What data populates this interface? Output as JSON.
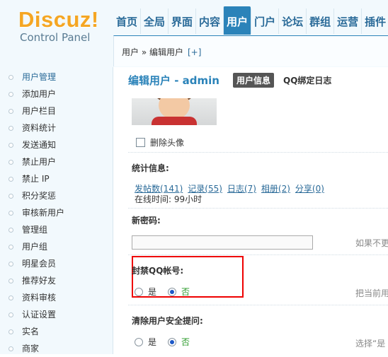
{
  "logo": {
    "title": "Discuz!",
    "subtitle": "Control Panel"
  },
  "nav": [
    "首页",
    "全局",
    "界面",
    "内容",
    "用户",
    "门户",
    "论坛",
    "群组",
    "运营",
    "插件"
  ],
  "nav_active": "用户",
  "breadcrumb": {
    "text": "用户 » 编辑用户",
    "add": "[+]"
  },
  "sidebar": {
    "items": [
      "用户管理",
      "添加用户",
      "用户栏目",
      "资料统计",
      "发送通知",
      "禁止用户",
      "禁止 IP",
      "积分奖惩",
      "审核新用户",
      "管理组",
      "用户组",
      "明星会员",
      "推荐好友",
      "资料审核",
      "认证设置",
      "实名",
      "商家"
    ],
    "active": "用户管理"
  },
  "main": {
    "title": "编辑用户 - admin",
    "tabs": [
      "用户信息",
      "QQ绑定日志"
    ],
    "delete_avatar": "删除头像",
    "stats_label": "统计信息:",
    "stats_links": [
      "发帖数(141)",
      "记录(55)",
      "日志(7)",
      "相册(2)",
      "分享(0)"
    ],
    "online_time": "在线时间: 99小时",
    "new_password_label": "新密码:",
    "new_password_hint": "如果不更",
    "ban_qq_label": "封禁QQ帐号:",
    "ban_qq_hint": "把当前用",
    "clear_security_label": "清除用户安全提问:",
    "clear_security_hint": "选择“是",
    "yes": "是",
    "no": "否"
  },
  "colors": {
    "accent": "#2b83b9",
    "logo": "#f5a623",
    "highlight_box": "#ee0000",
    "no_option": "#2a9a2a"
  }
}
